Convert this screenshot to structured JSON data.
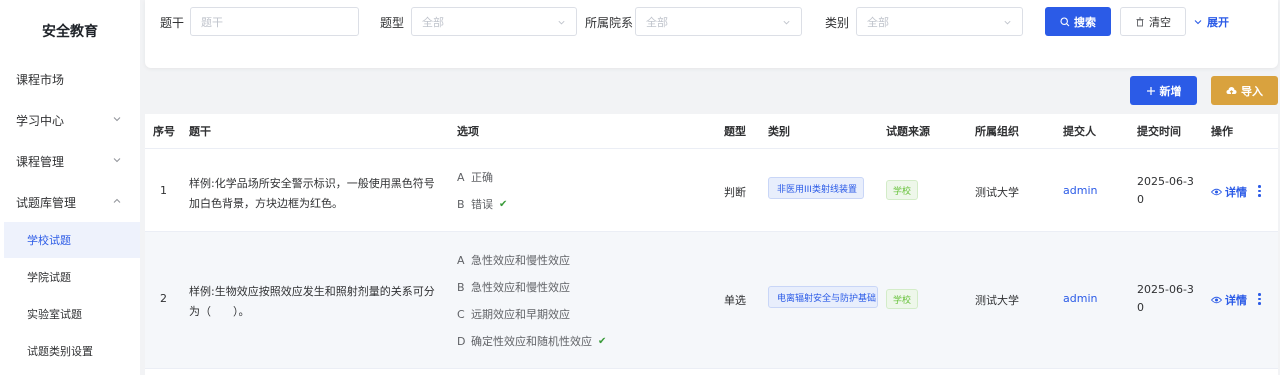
{
  "app": {
    "title": "安全教育"
  },
  "sidebar": {
    "items": [
      {
        "label": "课程市场"
      },
      {
        "label": "学习中心"
      },
      {
        "label": "课程管理"
      },
      {
        "label": "试题库管理"
      }
    ],
    "subitems": [
      {
        "label": "学校试题",
        "active": true
      },
      {
        "label": "学院试题"
      },
      {
        "label": "实验室试题"
      },
      {
        "label": "试题类别设置"
      }
    ]
  },
  "filters": {
    "stem_label": "题干",
    "stem_placeholder": "题干",
    "type_label": "题型",
    "type_value": "全部",
    "college_label": "所属院系",
    "college_value": "全部",
    "category_label": "类别",
    "category_value": "全部",
    "search_label": "搜索",
    "clear_label": "清空",
    "expand_label": "展开"
  },
  "toolbar": {
    "add_label": "新增",
    "import_label": "导入"
  },
  "table": {
    "headers": {
      "index": "序号",
      "stem": "题干",
      "options": "选项",
      "type": "题型",
      "category": "类别",
      "source": "试题来源",
      "org": "所属组织",
      "submitter": "提交人",
      "time": "提交时间",
      "action": "操作"
    },
    "rows": [
      {
        "index": "1",
        "stem": "样例:化学品场所安全警示标识，一般使用黑色符号加白色背景，方块边框为红色。",
        "options": [
          {
            "letter": "A",
            "text": "正确",
            "correct": false
          },
          {
            "letter": "B",
            "text": "错误",
            "correct": true
          }
        ],
        "type": "判断",
        "category": "非医用III类射线装置",
        "source": "学校",
        "org": "测试大学",
        "submitter": "admin",
        "time_line1": "2025-06-3",
        "time_line2": "0",
        "action": "详情"
      },
      {
        "index": "2",
        "stem": "样例:生物效应按照效应发生和照射剂量的关系可分为（　　）。",
        "options": [
          {
            "letter": "A",
            "text": "急性效应和慢性效应",
            "correct": false
          },
          {
            "letter": "B",
            "text": "急性效应和慢性效应",
            "correct": false
          },
          {
            "letter": "C",
            "text": "远期效应和早期效应",
            "correct": false
          },
          {
            "letter": "D",
            "text": "确定性效应和随机性效应",
            "correct": true
          }
        ],
        "type": "单选",
        "category": "电离辐射安全与防护基础",
        "source": "学校",
        "org": "测试大学",
        "submitter": "admin",
        "time_line1": "2025-06-3",
        "time_line2": "0",
        "action": "详情"
      }
    ],
    "check_mark": "✔"
  },
  "colors": {
    "primary": "#2b5be7",
    "warning": "#d9a23e",
    "success": "#67c23a"
  }
}
